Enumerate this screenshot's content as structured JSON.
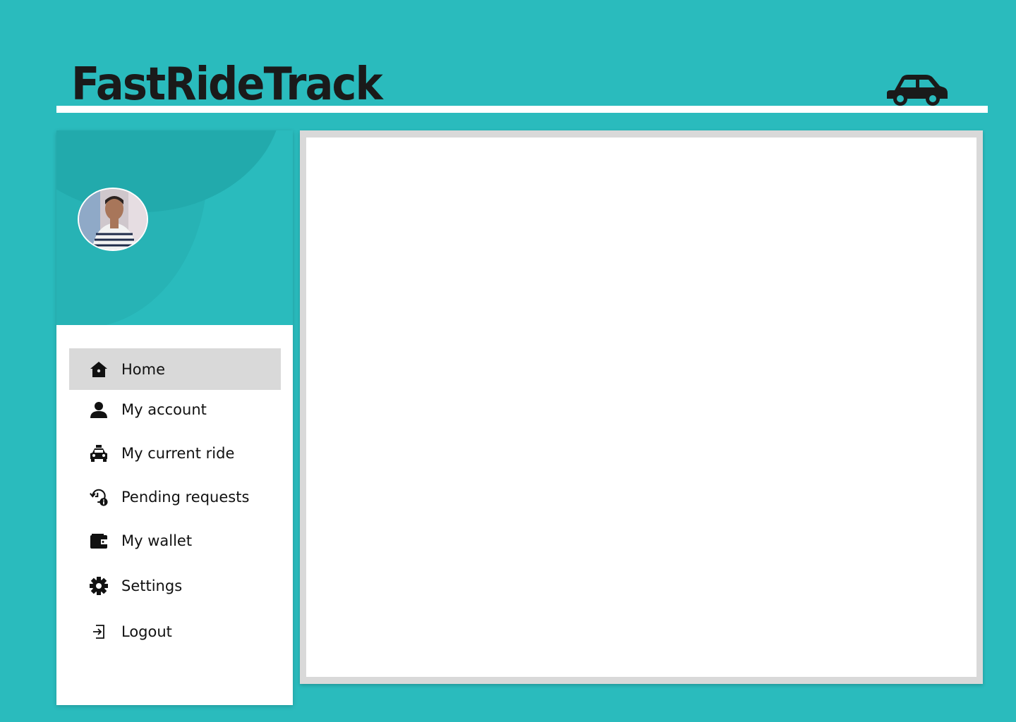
{
  "app": {
    "title": "FastRideTrack"
  },
  "sidebar": {
    "items": [
      {
        "label": "Home",
        "icon": "home-icon",
        "active": true
      },
      {
        "label": "My account",
        "icon": "user-icon",
        "active": false
      },
      {
        "label": "My current ride",
        "icon": "taxi-icon",
        "active": false
      },
      {
        "label": "Pending requests",
        "icon": "history-info-icon",
        "active": false
      },
      {
        "label": "My wallet",
        "icon": "wallet-icon",
        "active": false
      },
      {
        "label": "Settings",
        "icon": "gear-icon",
        "active": false
      },
      {
        "label": "Logout",
        "icon": "logout-icon",
        "active": false
      }
    ]
  },
  "colors": {
    "background": "#2abbbd",
    "active_item": "#d9d9d9",
    "text": "#111111"
  }
}
